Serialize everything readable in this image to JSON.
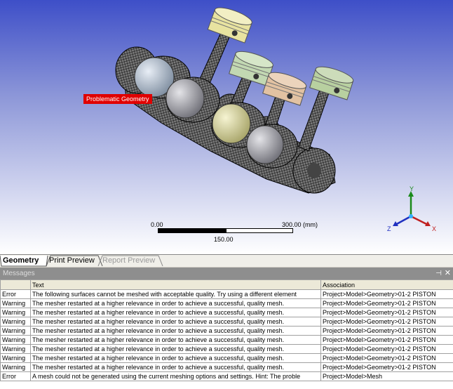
{
  "viewport": {
    "problem_label": "Problematic Geometry",
    "scale": {
      "min": "0.00",
      "mid": "150.00",
      "max": "300.00 (mm)"
    },
    "triad": {
      "y": "Y",
      "z": "Z",
      "x": "X"
    }
  },
  "tabs": [
    {
      "label": "Geometry",
      "active": true
    },
    {
      "label": "Print Preview",
      "active": false
    },
    {
      "label": "Report Preview",
      "active": false
    }
  ],
  "messages": {
    "title": "Messages",
    "pin": "⊣",
    "close": "✕",
    "columns": [
      "",
      "Text",
      "Association"
    ],
    "rows": [
      {
        "type": "Error",
        "text": "The following surfaces cannot be meshed with acceptable quality. Try using a different element",
        "assoc": "Project>Model>Geometry>01-2  PISTON"
      },
      {
        "type": "Warning",
        "text": "The mesher restarted at a higher relevance in order to achieve a successful, quality mesh.",
        "assoc": "Project>Model>Geometry>01-2  PISTON"
      },
      {
        "type": "Warning",
        "text": "The mesher restarted at a higher relevance in order to achieve a successful, quality mesh.",
        "assoc": "Project>Model>Geometry>01-2  PISTON"
      },
      {
        "type": "Warning",
        "text": "The mesher restarted at a higher relevance in order to achieve a successful, quality mesh.",
        "assoc": "Project>Model>Geometry>01-2  PISTON"
      },
      {
        "type": "Warning",
        "text": "The mesher restarted at a higher relevance in order to achieve a successful, quality mesh.",
        "assoc": "Project>Model>Geometry>01-2  PISTON"
      },
      {
        "type": "Warning",
        "text": "The mesher restarted at a higher relevance in order to achieve a successful, quality mesh.",
        "assoc": "Project>Model>Geometry>01-2  PISTON"
      },
      {
        "type": "Warning",
        "text": "The mesher restarted at a higher relevance in order to achieve a successful, quality mesh.",
        "assoc": "Project>Model>Geometry>01-2  PISTON"
      },
      {
        "type": "Warning",
        "text": "The mesher restarted at a higher relevance in order to achieve a successful, quality mesh.",
        "assoc": "Project>Model>Geometry>01-2  PISTON"
      },
      {
        "type": "Warning",
        "text": "The mesher restarted at a higher relevance in order to achieve a successful, quality mesh.",
        "assoc": "Project>Model>Geometry>01-2  PISTON"
      },
      {
        "type": "Error",
        "text": "A mesh could not be generated using the current meshing options and settings. Hint: The proble",
        "assoc": "Project>Model>Mesh"
      }
    ]
  },
  "colors": {
    "piston_yellow": "#e8e3a0",
    "piston_green_a": "#c2d8b2",
    "piston_tan": "#e2c2a2",
    "piston_green_b": "#b8d0a0",
    "piston_blue": "#b8c8dc",
    "piston_grey": "#c8c8cc",
    "error_label": "#e00000"
  }
}
